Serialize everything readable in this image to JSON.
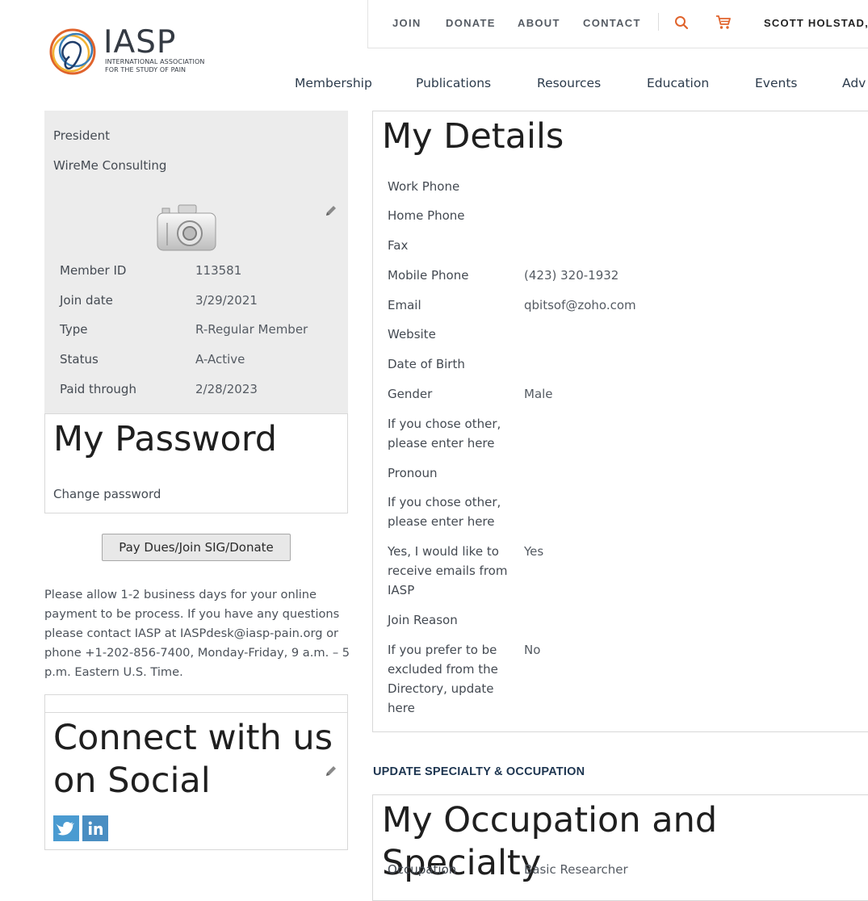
{
  "brand": {
    "name": "IASP",
    "subtitle_line1": "INTERNATIONAL ASSOCIATION",
    "subtitle_line2": "FOR THE STUDY OF PAIN",
    "accent": "#e0632c"
  },
  "top_nav": {
    "join": "JOIN",
    "donate": "DONATE",
    "about": "ABOUT",
    "contact": "CONTACT",
    "user": "SCOTT HOLSTAD,"
  },
  "main_nav": [
    "Membership",
    "Publications",
    "Resources",
    "Education",
    "Events",
    "Adv"
  ],
  "profile": {
    "title": "President",
    "company": "WireMe Consulting",
    "fields": [
      {
        "label": "Member ID",
        "value": "113581"
      },
      {
        "label": "Join date",
        "value": "3/29/2021"
      },
      {
        "label": "Type",
        "value": "R-Regular Member"
      },
      {
        "label": "Status",
        "value": "A-Active"
      },
      {
        "label": "Paid through",
        "value": "2/28/2023"
      }
    ]
  },
  "password": {
    "heading": "My Password",
    "link": "Change password"
  },
  "pay_button": "Pay Dues/Join SIG/Donate",
  "payment_note": {
    "line1": "Please allow 1-2 business days for your online",
    "line2": "payment to be process.  If you have any questions",
    "line3": "please contact IASP at IASPdesk@iasp-pain.org or",
    "line4": "phone +1-202-856-7400, Monday-Friday, 9 a.m. – 5",
    "line5": "p.m. Eastern U.S. Time."
  },
  "social": {
    "heading_line1": "Connect with us",
    "heading_line2": "on Social",
    "icons": [
      "twitter-icon",
      "linkedin-icon"
    ]
  },
  "details": {
    "heading": "My Details",
    "rows": [
      {
        "label": "Work Phone",
        "value": ""
      },
      {
        "label": "Home Phone",
        "value": ""
      },
      {
        "label": "Fax",
        "value": ""
      },
      {
        "label": "Mobile Phone",
        "value": "(423) 320-1932"
      },
      {
        "label": "Email",
        "value": "qbitsof@zoho.com"
      },
      {
        "label": "Website",
        "value": ""
      },
      {
        "label": "Date of Birth",
        "value": ""
      },
      {
        "label": "Gender",
        "value": "Male"
      },
      {
        "label": "If you chose other, please enter here",
        "value": ""
      },
      {
        "label": "Pronoun",
        "value": ""
      },
      {
        "label": "If you chose other, please enter here",
        "value": ""
      },
      {
        "label": "Yes, I would like to receive emails from IASP",
        "value": "Yes"
      },
      {
        "label": "Join Reason",
        "value": ""
      },
      {
        "label": "If you prefer to be excluded from the Directory, update here",
        "value": "No"
      }
    ]
  },
  "specialty": {
    "link": "UPDATE SPECIALTY & OCCUPATION",
    "heading": "My Occupation and Specialty",
    "occupation_label": "Occupation",
    "occupation_value": "Basic Researcher"
  }
}
